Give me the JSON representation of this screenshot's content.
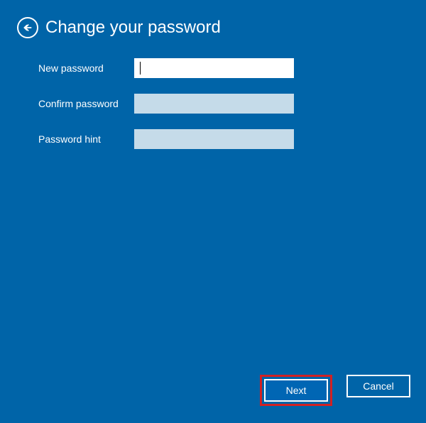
{
  "header": {
    "title": "Change your password"
  },
  "form": {
    "new_password_label": "New password",
    "new_password_value": "",
    "confirm_password_label": "Confirm password",
    "confirm_password_value": "",
    "password_hint_label": "Password hint",
    "password_hint_value": ""
  },
  "footer": {
    "next_label": "Next",
    "cancel_label": "Cancel"
  }
}
